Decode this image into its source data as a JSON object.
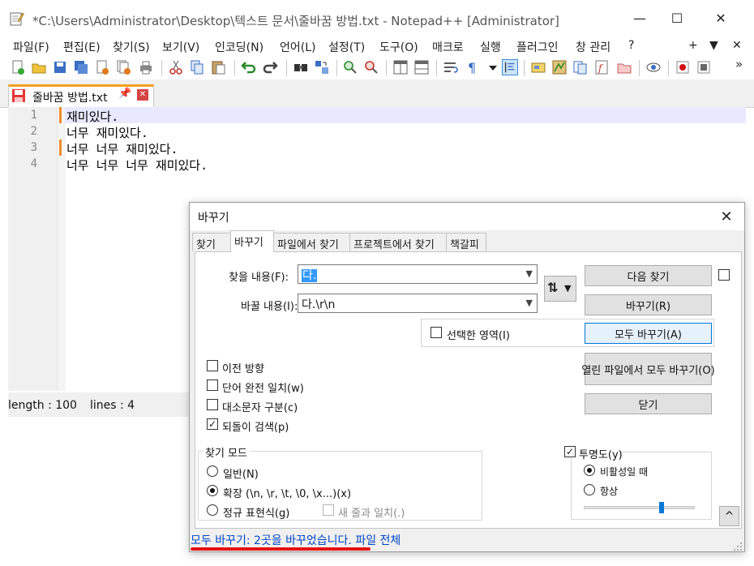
{
  "window": {
    "title": "*C:\\Users\\Administrator\\Desktop\\텍스트 문서\\줄바꿈 방법.txt - Notepad++ [Administrator]",
    "minimize": "—",
    "maximize": "☐",
    "close": "✕"
  },
  "menubar": {
    "items": [
      "파일(F)",
      "편집(E)",
      "찾기(S)",
      "보기(V)",
      "인코딩(N)",
      "언어(L)",
      "설정(T)",
      "도구(O)",
      "매크로",
      "실행",
      "플러그인",
      "창 관리",
      "?"
    ],
    "right_controls": [
      "+",
      "▼",
      "✕"
    ]
  },
  "toolbar": {
    "overflow": "»"
  },
  "tab": {
    "label": "줄바꿈 방법.txt",
    "pin": "📌",
    "close": "✕"
  },
  "editor": {
    "lines": [
      {
        "number": "1",
        "text": "재미있다."
      },
      {
        "number": "2",
        "text": "너무 재미있다."
      },
      {
        "number": "3",
        "text": "너무 너무 재미있다."
      },
      {
        "number": "4",
        "text": "너무 너무 너무 재미있다."
      }
    ]
  },
  "status": {
    "length": "length : 100",
    "lines": "lines : 4"
  },
  "dialog": {
    "title": "바꾸기",
    "close": "✕",
    "tabs": [
      "찾기",
      "바꾸기",
      "파일에서 찾기",
      "프로젝트에서 찾기",
      "책갈피"
    ],
    "active_tab": "바꾸기",
    "find_label": "찾을 내용(F):",
    "find_value": "다.",
    "replace_label": "바꿀 내용(I):",
    "replace_value": "다.\\r\\n",
    "swap_icon": "⇅",
    "buttons": {
      "find_next": "다음 찾기",
      "replace": "바꾸기(R)",
      "replace_all": "모두 바꾸기(A)",
      "replace_all_open": "열린 파일에서 모두 바꾸기(O)",
      "close": "닫기",
      "collapse": "^"
    },
    "in_selection": {
      "label": "선택한 영역(I)",
      "checked": false
    },
    "options": [
      {
        "label": "이전 방향",
        "checked": false
      },
      {
        "label": "단어 완전 일치(w)",
        "checked": false
      },
      {
        "label": "대소문자 구분(c)",
        "checked": false
      },
      {
        "label": "되돌이 검색(p)",
        "checked": true
      }
    ],
    "search_mode": {
      "title": "찾기 모드",
      "options": [
        {
          "label": "일반(N)",
          "selected": false
        },
        {
          "label": "확장 (\\n, \\r, \\t, \\0, \\x...)(x)",
          "selected": true
        },
        {
          "label": "정규 표현식(g)",
          "selected": false
        }
      ],
      "dot_matches_newline": {
        "label": "새 줄과 일치(.)",
        "checked": false,
        "enabled": false
      }
    },
    "transparency": {
      "title": "투명도(y)",
      "checked": true,
      "options": [
        {
          "label": "비활성일 때",
          "selected": true
        },
        {
          "label": "항상",
          "selected": false
        }
      ],
      "slider_level": 0.71
    },
    "status_text": "모두 바꾸기: 2곳을 바꾸었습니다. 파일 전체"
  },
  "colors": {
    "accent": "#0078d7",
    "status_text": "#0045c8",
    "highlight_underline": "#e81010",
    "selection": "#3399ff",
    "change_marker": "#f08d2a",
    "tab_indicator": "#f4a020"
  }
}
